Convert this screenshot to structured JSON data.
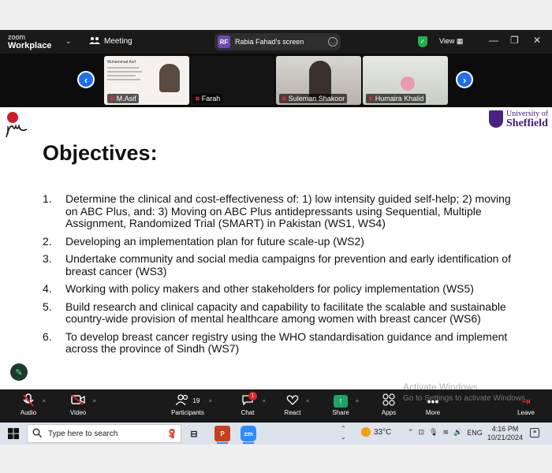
{
  "titlebar": {
    "logo_line1": "zoom",
    "logo_line2": "Workplace",
    "meeting_label": "Meeting",
    "screen_initials": "RF",
    "screen_label": "Rabia Fahad's screen",
    "view_label": "View"
  },
  "participants_strip": [
    {
      "name": "M.Asif",
      "muted": true
    },
    {
      "name": "Farah",
      "muted": true
    },
    {
      "name": "Suleman Shakoor",
      "muted": true
    },
    {
      "name": "Humaira Khalid",
      "muted": true
    }
  ],
  "thumb_slide_text": "Muhammad Asif",
  "slide": {
    "title": "Objectives:",
    "logo_university_line1": "University of",
    "logo_university_line2": "Sheffield",
    "objectives": [
      {
        "num": "1.",
        "text": "Determine the clinical and cost-effectiveness of: 1) low intensity guided self-help; 2) moving on ABC Plus, and: 3) Moving on ABC Plus antidepressants using Sequential, Multiple Assignment, Randomized Trial (SMART) in Pakistan (WS1, WS4)"
      },
      {
        "num": "2.",
        "text": "Developing an implementation plan for future scale-up (WS2)"
      },
      {
        "num": "3.",
        "text": "Undertake community and social media campaigns for prevention and early identification of breast cancer (WS3)"
      },
      {
        "num": "4.",
        "text": "Working with policy makers and other stakeholders for policy implementation (WS5)"
      },
      {
        "num": "5.",
        "text": "Build research and clinical capacity and capability to facilitate the scalable and sustainable country-wide provision of mental healthcare among women with breast cancer (WS6)"
      },
      {
        "num": "6.",
        "text": "To develop breast cancer registry using the WHO standardisation guidance and implement across the province of Sindh (WS7)"
      }
    ]
  },
  "controls": {
    "audio": "Audio",
    "video": "Video",
    "participants": "Participants",
    "participants_count": "19",
    "chat": "Chat",
    "chat_badge": "1",
    "react": "React",
    "share": "Share",
    "apps": "Apps",
    "more": "More",
    "leave": "Leave"
  },
  "watermark": {
    "line1": "Activate Windows",
    "line2": "Go to Settings to activate Windows."
  },
  "taskbar": {
    "search_placeholder": "Type here to search",
    "temperature": "33°C",
    "language": "ENG",
    "time": "4:16 PM",
    "date": "10/21/2024"
  },
  "colors": {
    "zoom_blue": "#1f6feb",
    "zoom_dark": "#1a1a1a",
    "share_green": "#1fa463",
    "sheffield_purple": "#4a2382"
  }
}
